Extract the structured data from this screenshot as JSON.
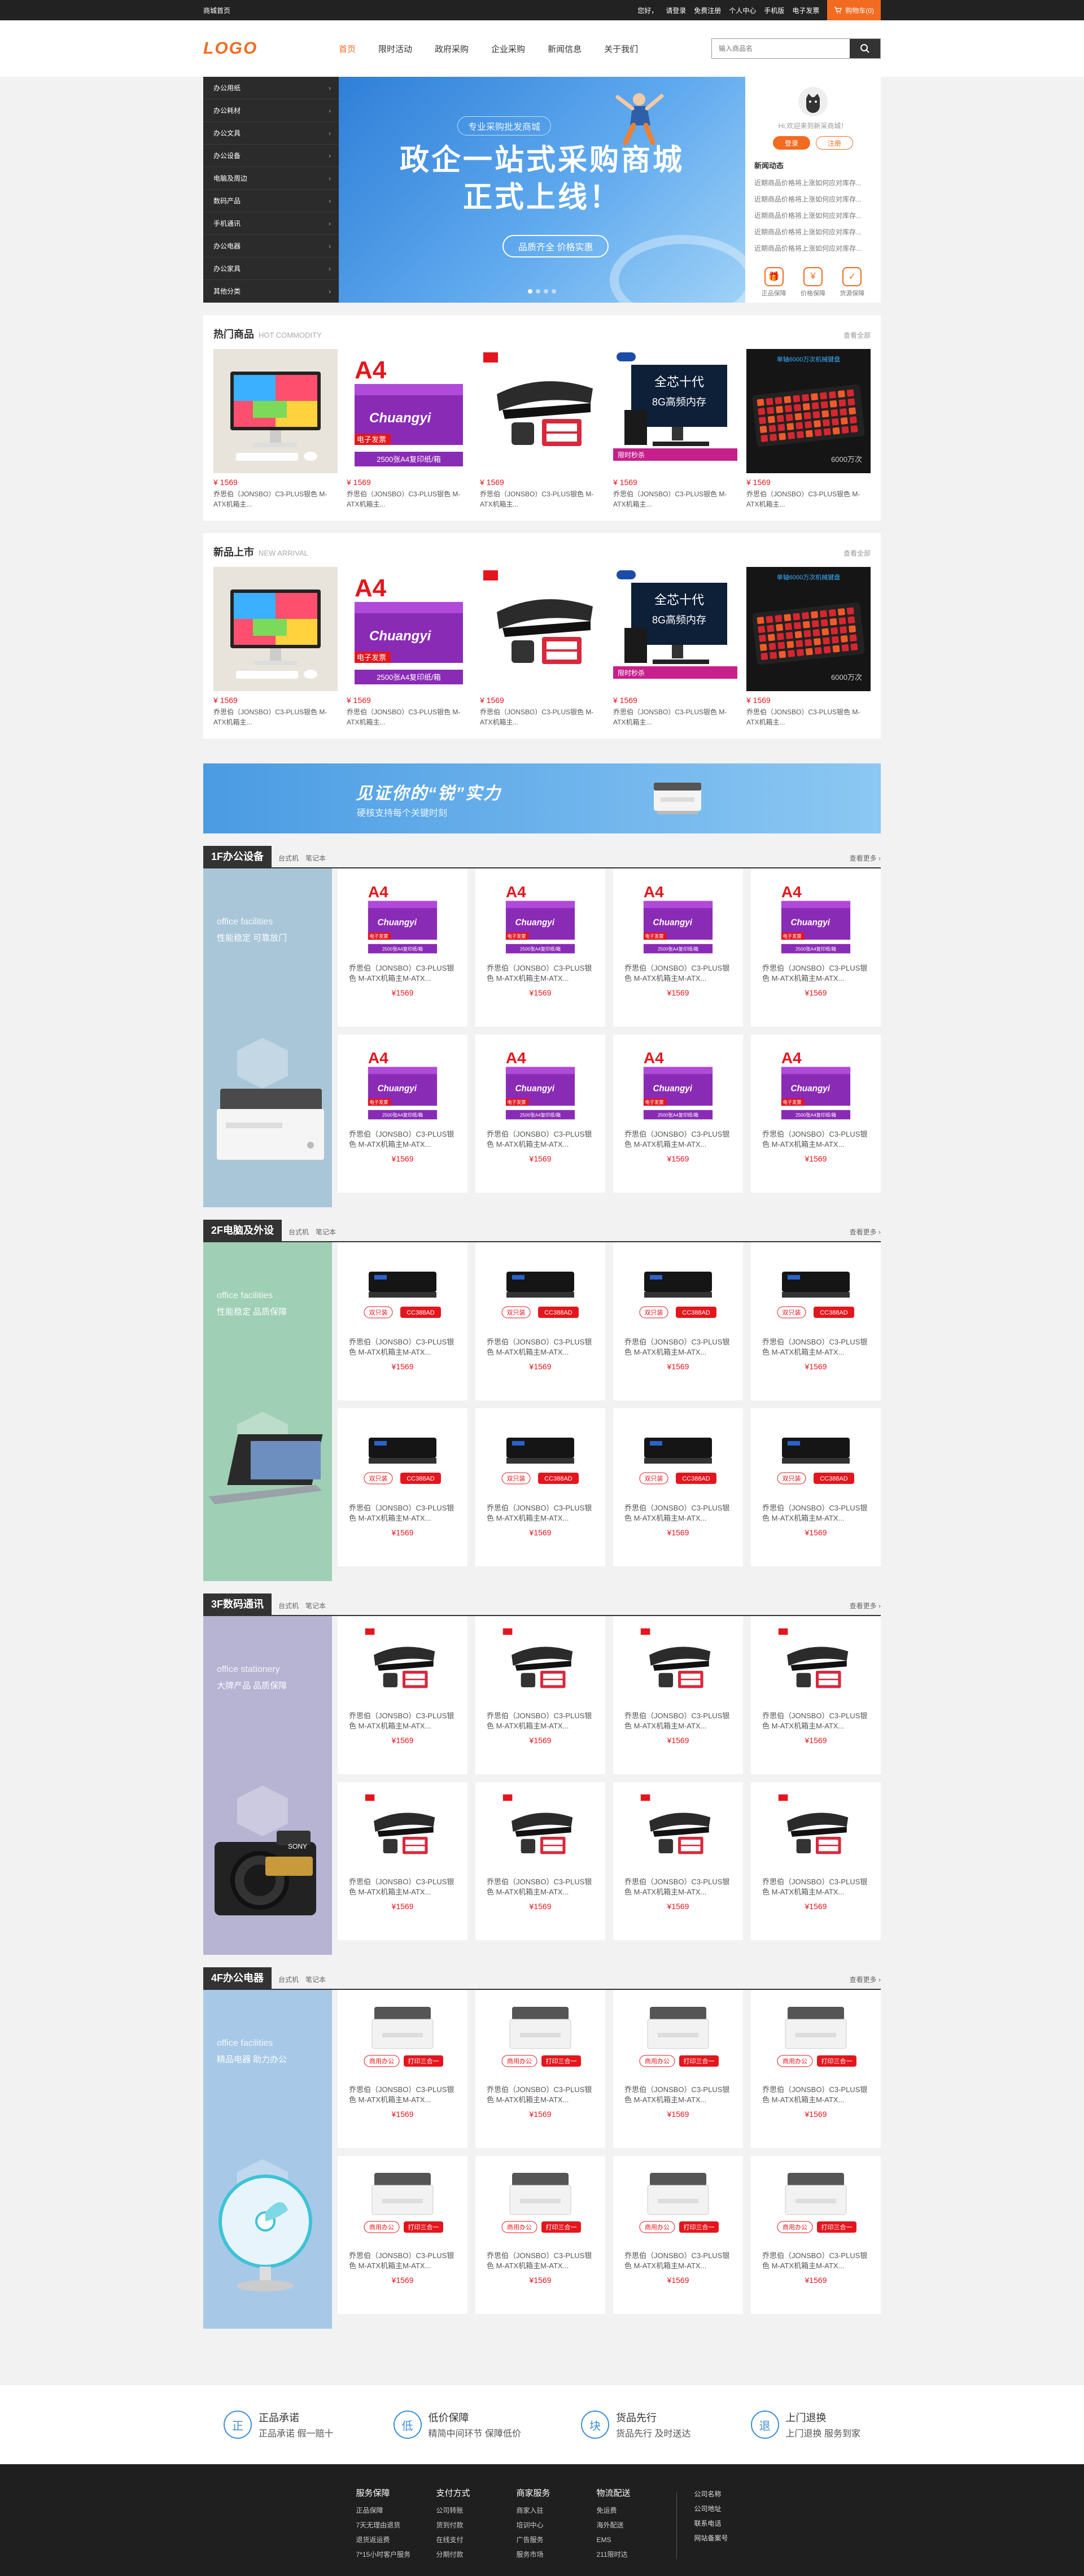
{
  "topbar": {
    "left": "商城首页",
    "links": [
      "您好，",
      "请登录",
      "免费注册",
      "个人中心",
      "手机版",
      "电子发票"
    ],
    "cart": "购物车(0)"
  },
  "header": {
    "logo": "LOGO",
    "nav": [
      "首页",
      "限时活动",
      "政府采购",
      "企业采购",
      "新闻信息",
      "关于我们"
    ],
    "search_placeholder": "输入商品名"
  },
  "sidemenu": [
    "办公用纸",
    "办公耗材",
    "办公文具",
    "办公设备",
    "电脑及周边",
    "数码产品",
    "手机通讯",
    "办公电器",
    "办公家具",
    "其他分类"
  ],
  "banner": {
    "sub": "专业采购批发商城",
    "line1": "政企一站式采购商城",
    "line2": "正式上线！",
    "pill": "品质齐全 价格实惠"
  },
  "user": {
    "greeting": "Hi,欢迎来到新采商城！",
    "login": "登录",
    "register": "注册",
    "news_title": "新闻动态",
    "news": [
      "近期商品价格将上涨如何应对库存...",
      "近期商品价格将上涨如何应对库存...",
      "近期商品价格将上涨如何应对库存...",
      "近期商品价格将上涨如何应对库存...",
      "近期商品价格将上涨如何应对库存..."
    ],
    "services": [
      "正品保障",
      "价格保障",
      "货源保障"
    ]
  },
  "hot": {
    "title": "热门商品",
    "en": "HOT COMMODITY",
    "more": "查看全部",
    "items": [
      {
        "price": "¥ 1569",
        "name": "乔思伯（JONSBO）C3-PLUS银色 M-ATX机箱主..."
      },
      {
        "price": "¥ 1569",
        "name": "乔思伯（JONSBO）C3-PLUS银色 M-ATX机箱主..."
      },
      {
        "price": "¥ 1569",
        "name": "乔思伯（JONSBO）C3-PLUS银色 M-ATX机箱主..."
      },
      {
        "price": "¥ 1569",
        "name": "乔思伯（JONSBO）C3-PLUS银色 M-ATX机箱主..."
      },
      {
        "price": "¥ 1569",
        "name": "乔思伯（JONSBO）C3-PLUS银色 M-ATX机箱主..."
      }
    ]
  },
  "newp": {
    "title": "新品上市",
    "en": "NEW ARRIVAL",
    "more": "查看全部",
    "items": [
      {
        "price": "¥ 1569",
        "name": "乔思伯（JONSBO）C3-PLUS银色 M-ATX机箱主..."
      },
      {
        "price": "¥ 1569",
        "name": "乔思伯（JONSBO）C3-PLUS银色 M-ATX机箱主..."
      },
      {
        "price": "¥ 1569",
        "name": "乔思伯（JONSBO）C3-PLUS银色 M-ATX机箱主..."
      },
      {
        "price": "¥ 1569",
        "name": "乔思伯（JONSBO）C3-PLUS银色 M-ATX机箱主..."
      },
      {
        "price": "¥ 1569",
        "name": "乔思伯（JONSBO）C3-PLUS银色 M-ATX机箱主..."
      }
    ]
  },
  "product_labels": {
    "a4": "A4",
    "a4_brand": "Chuangyi",
    "a4_tag": "电子发票",
    "a4_foot": "2500张A4复印纸/箱",
    "pc_text1": "全芯十代",
    "pc_text2": "8G高频内存",
    "pc_tag": "限时秒杀",
    "kb_text": "单轴6000万次机械键盘",
    "kb_foot": "6000万次",
    "toner_left": "双只装",
    "toner_right": "CC388AD",
    "printer_left": "商用办公",
    "printer_right": "打印三合一"
  },
  "ad": {
    "headline": "见证你的“锐”实力",
    "sub": "硬核支持每个关键时刻"
  },
  "floors": [
    {
      "label": "1F办公设备",
      "tabs": [
        "台式机",
        "笔记本"
      ],
      "more": "查看更多",
      "promo_en": "office facilities",
      "promo_cn": "性能稳定 可靠放门",
      "promo_color": "#a9c6d9",
      "item_type": "paper",
      "name": "乔思伯（JONSBO）C3-PLUS银色 M-ATX机箱主M-ATX...",
      "price": "¥1569"
    },
    {
      "label": "2F电脑及外设",
      "tabs": [
        "台式机",
        "笔记本"
      ],
      "more": "查看更多",
      "promo_en": "office facilities",
      "promo_cn": "性能稳定 品质保障",
      "promo_color": "#9fcfb4",
      "item_type": "toner",
      "name": "乔思伯（JONSBO）C3-PLUS银色 M-ATX机箱主M-ATX...",
      "price": "¥1569"
    },
    {
      "label": "3F数码通讯",
      "tabs": [
        "台式机",
        "笔记本"
      ],
      "more": "查看更多",
      "promo_en": "office stationery",
      "promo_cn": "大牌产品 品质保障",
      "promo_color": "#b6b3d3",
      "item_type": "stapler",
      "name": "乔思伯（JONSBO）C3-PLUS银色 M-ATX机箱主M-ATX...",
      "price": "¥1569"
    },
    {
      "label": "4F办公电器",
      "tabs": [
        "台式机",
        "笔记本"
      ],
      "more": "查看更多",
      "promo_en": "office facilities",
      "promo_cn": "精品电器 助力办公",
      "promo_color": "#a7c9e7",
      "item_type": "printer",
      "name": "乔思伯（JONSBO）C3-PLUS银色 M-ATX机箱主M-ATX...",
      "price": "¥1569"
    }
  ],
  "guarantee": [
    {
      "icon": "正",
      "title": "正品承诺",
      "desc": "正品承诺 假一赔十"
    },
    {
      "icon": "低",
      "title": "低价保障",
      "desc": "精简中间环节 保障低价"
    },
    {
      "icon": "块",
      "title": "货品先行",
      "desc": "货品先行 及时送达"
    },
    {
      "icon": "退",
      "title": "上门退换",
      "desc": "上门退换 服务到家"
    }
  ],
  "footer": {
    "cols": [
      {
        "h": "服务保障",
        "items": [
          "正品保障",
          "7天无理由退货",
          "退货返运费",
          "7*15小时客户服务"
        ]
      },
      {
        "h": "支付方式",
        "items": [
          "公司转账",
          "货到付款",
          "在线支付",
          "分期付款"
        ]
      },
      {
        "h": "商家服务",
        "items": [
          "商家入驻",
          "培训中心",
          "广告服务",
          "服务市场"
        ]
      },
      {
        "h": "物流配送",
        "items": [
          "免运费",
          "海外配送",
          "EMS",
          "211限时达"
        ]
      }
    ],
    "company": [
      "公司名称",
      "公司地址",
      "联系电话",
      "网站备案号"
    ]
  },
  "colors": {
    "accent": "#f26b21",
    "price": "#e4161d",
    "dark": "#222222"
  }
}
